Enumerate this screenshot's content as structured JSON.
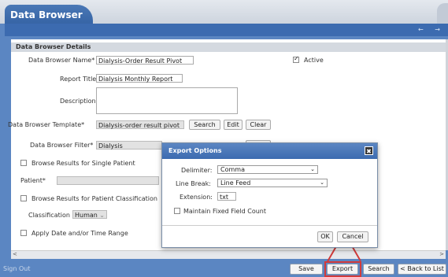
{
  "window": {
    "title": "Data Browser",
    "nav_arrows": "← →"
  },
  "section": {
    "title": "Data Browser Details"
  },
  "form": {
    "name_label": "Data Browser Name*",
    "name_value": "Dialysis-Order Result Pivot",
    "active_label": "Active",
    "active_checked": true,
    "report_title_label": "Report Title",
    "report_title_value": "Dialysis Monthly Report",
    "description_label": "Description",
    "template_label": "Data Browser Template*",
    "template_value": "Dialysis-order result pivot",
    "search_button": "Search",
    "edit_button": "Edit",
    "clear_button": "Clear",
    "filter_label": "Data Browser Filter*",
    "filter_value": "Dialysis",
    "single_patient_label": "Browse Results for Single Patient",
    "patient_label": "Patient*",
    "classification_browse_label": "Browse Results for Patient Classification",
    "classification_label": "Classification",
    "classification_value": "Human",
    "date_range_label": "Apply Date and/or Time Range"
  },
  "modal": {
    "title": "Export Options",
    "close_glyph": "✖",
    "delimiter_label": "Delimiter:",
    "delimiter_value": "Comma",
    "linebreak_label": "Line Break:",
    "linebreak_value": "Line Feed",
    "extension_label": "Extension:",
    "extension_value": "txt",
    "maintain_label": "Maintain Fixed Field Count",
    "ok_button": "OK",
    "cancel_button": "Cancel"
  },
  "bottom": {
    "sign_out": "Sign Out",
    "save": "Save",
    "export": "Export",
    "search": "Search",
    "back": "< Back to List"
  },
  "colors": {
    "accent": "#3c6bb0",
    "highlight": "#d23b3b"
  }
}
